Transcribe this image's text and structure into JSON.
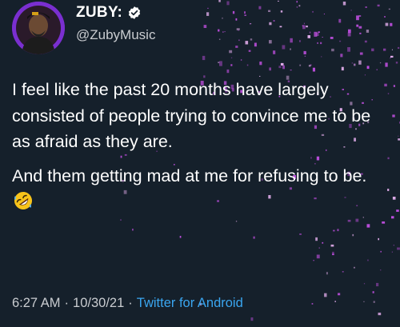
{
  "author": {
    "display_name": "ZUBY:",
    "handle": "@ZubyMusic",
    "verified": true,
    "avatar_icon": "profile-photo"
  },
  "tweet": {
    "paragraph_1": "I feel like the past 20 months have largely consisted of people trying to convince me to be as afraid as they are.",
    "paragraph_2": "And them getting mad at me for refusing to be.",
    "emoji": "rolling-on-the-floor-laughing-emoji"
  },
  "meta": {
    "time": "6:27 AM",
    "separator": "·",
    "date": "10/30/21",
    "source": "Twitter for Android"
  },
  "colors": {
    "background": "#15202b",
    "text": "#ffffff",
    "secondary_text": "#c9ccd0",
    "link": "#3aa6f0",
    "confetti": "#c04fe0"
  }
}
